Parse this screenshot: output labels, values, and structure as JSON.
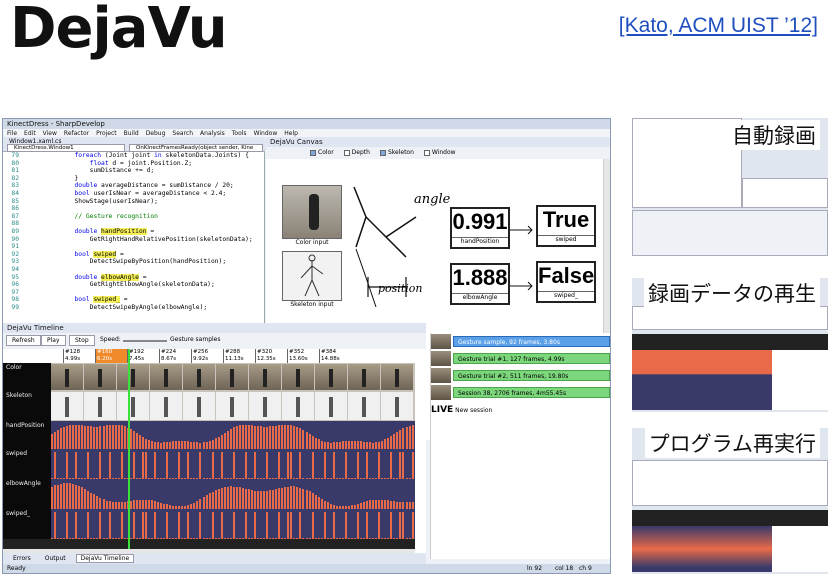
{
  "heading": {
    "title": "DejaVu",
    "citation": "[Kato, ACM UIST ’12]"
  },
  "window": {
    "title": "KinectDress - SharpDevelop",
    "menu": [
      "File",
      "Edit",
      "View",
      "Refactor",
      "Project",
      "Build",
      "Debug",
      "Search",
      "Analysis",
      "Tools",
      "Window",
      "Help"
    ],
    "file_tab": "Window1.xaml.cs",
    "class_combo": "KinectDress.Window1",
    "method_combo": "OnKinectFramesReady(object sender, Kine"
  },
  "code": [
    {
      "n": "79",
      "t": "            foreach (Joint joint in skeletonData.Joints) {"
    },
    {
      "n": "80",
      "t": "                float d = joint.Position.Z;"
    },
    {
      "n": "81",
      "t": "                sumDistance += d;"
    },
    {
      "n": "82",
      "t": "            }"
    },
    {
      "n": "83",
      "t": "            double averageDistance = sumDistance / 20;"
    },
    {
      "n": "84",
      "t": "            bool userIsNear = averageDistance < 2.4;"
    },
    {
      "n": "85",
      "t": "            ShowStage(userIsNear);"
    },
    {
      "n": "86",
      "t": ""
    },
    {
      "n": "87",
      "t": "            // Gesture recognition"
    },
    {
      "n": "88",
      "t": ""
    },
    {
      "n": "89",
      "t": "            double handPosition ="
    },
    {
      "n": "90",
      "t": "                GetRightHandRelativePosition(skeletonData);"
    },
    {
      "n": "91",
      "t": ""
    },
    {
      "n": "92",
      "t": "            bool swiped ="
    },
    {
      "n": "93",
      "t": "                DetectSwipeByPosition(handPosition);"
    },
    {
      "n": "94",
      "t": ""
    },
    {
      "n": "95",
      "t": "            double elbowAngle ="
    },
    {
      "n": "96",
      "t": "                GetRightElbowAngle(skeletonData);"
    },
    {
      "n": "97",
      "t": ""
    },
    {
      "n": "98",
      "t": "            bool swiped_ ="
    },
    {
      "n": "99",
      "t": "                DetectSwipeByAngle(elbowAngle);"
    }
  ],
  "canvas": {
    "title": "DejaVu Canvas",
    "checks": [
      "Color",
      "Depth",
      "Skeleton",
      "Window"
    ],
    "color_input": "Color input",
    "skeleton_input": "Skeleton input",
    "sketch_angle": "angle",
    "sketch_position": "position",
    "values": [
      {
        "value": "0.991",
        "label": "handPosition"
      },
      {
        "value": "1.888",
        "label": "elbowAngle"
      }
    ],
    "outputs": [
      {
        "value": "True",
        "label": "swiped"
      },
      {
        "value": "False",
        "label": "swiped_"
      }
    ]
  },
  "timeline": {
    "title": "DejaVu Timeline",
    "buttons": [
      "Refresh",
      "Play",
      "Stop"
    ],
    "speed": "Speed:",
    "gesture_label": "Gesture samples",
    "ticks": [
      {
        "f": "#128",
        "t": "4.99s"
      },
      {
        "f": "#160",
        "t": "6.20s"
      },
      {
        "f": "#192",
        "t": "7.45s"
      },
      {
        "f": "#224",
        "t": "8.67s"
      },
      {
        "f": "#256",
        "t": "9.92s"
      },
      {
        "f": "#288",
        "t": "11.13s"
      },
      {
        "f": "#320",
        "t": "12.35s"
      },
      {
        "f": "#352",
        "t": "13.60s"
      },
      {
        "f": "#384",
        "t": "14.88s"
      }
    ],
    "rows": [
      "Color",
      "Skeleton",
      "handPosition",
      "swiped",
      "elbowAngle",
      "swiped_"
    ]
  },
  "sessions": [
    {
      "label": "Gesture sample, 92 frames, 3.80s"
    },
    {
      "label": "Gesture trial #1, 127 frames, 4.99s"
    },
    {
      "label": "Gesture trial #2, 511 frames, 19.80s"
    },
    {
      "label": "Session 38, 2706 frames, 4m55.45s"
    }
  ],
  "live": {
    "badge": "LIVE",
    "label": "New session"
  },
  "bottom_tabs": [
    "Errors",
    "Output",
    "DejaVu Timeline"
  ],
  "status": {
    "left": "Ready",
    "ln": "ln 92",
    "col": "col 18",
    "ch": "ch 9"
  },
  "features": [
    "自動録画",
    "録画データの再生",
    "プログラム再実行"
  ],
  "colors": {
    "accent": "#1f4fbf",
    "plot": "#e86a48",
    "plot_bg": "#3a3a6a",
    "highlight": "#f5ef58",
    "cursor": "#3ce03c"
  }
}
